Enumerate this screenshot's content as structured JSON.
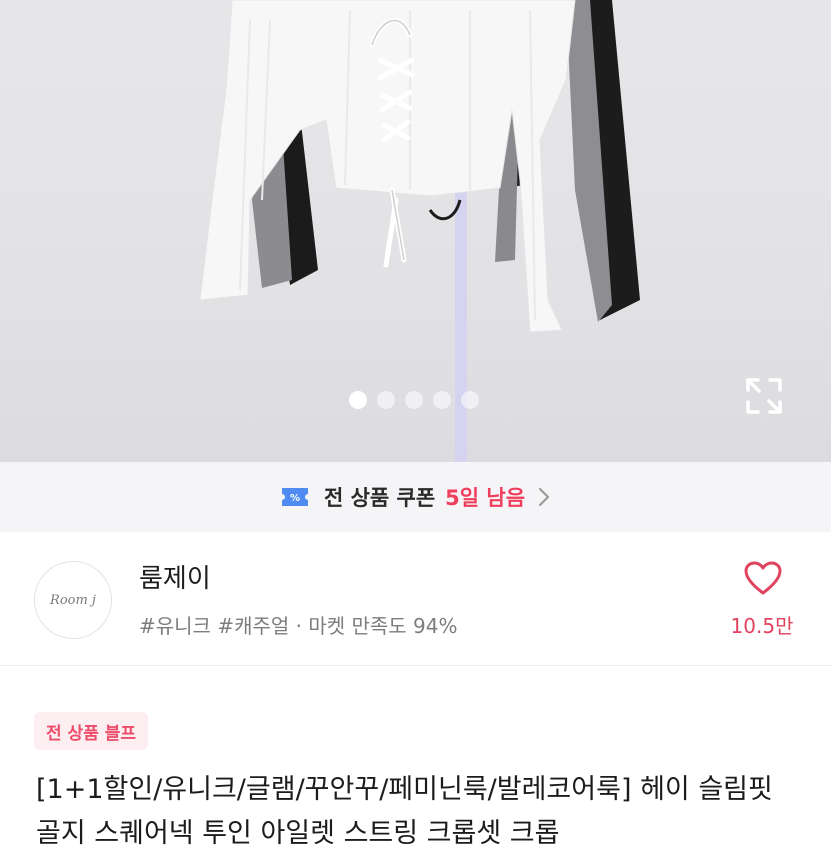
{
  "product_image": {
    "slide_count": 5,
    "active_slide": 1,
    "expand_icon": "expand-icon"
  },
  "coupon": {
    "icon": "coupon-ticket-icon",
    "label": "전 상품 쿠폰",
    "days_left": "5일 남음",
    "chevron_icon": "chevron-right-icon"
  },
  "shop": {
    "logo_text": "Room j",
    "name": "룸제이",
    "tags": "#유니크 #캐주얼 · 마켓 만족도 94%",
    "favorite_icon": "heart-icon",
    "favorite_count": "10.5만"
  },
  "product": {
    "badge": "전 상품 블프",
    "title": "[1+1할인/유니크/글램/꾸안꾸/페미닌룩/발레코어룩] 헤이 슬림핏 골지 스퀘어넥 투인 아일렛 스트링 크롭셋 크롭"
  },
  "colors": {
    "accent": "#ef3f5d",
    "coupon_bg": "#f5f5f7",
    "badge_bg": "#fdeef1"
  }
}
